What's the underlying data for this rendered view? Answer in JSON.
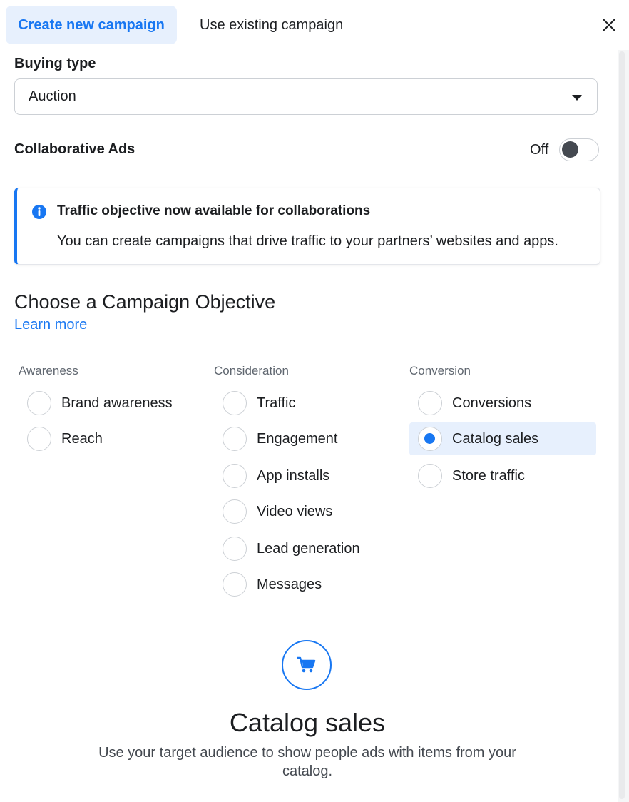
{
  "tabs": {
    "create": "Create new campaign",
    "existing": "Use existing campaign"
  },
  "icons": {
    "close": "close-icon",
    "info": "info-icon",
    "dropdown": "caret-down-icon",
    "cart": "shopping-cart-icon"
  },
  "buying_type": {
    "label": "Buying type",
    "value": "Auction"
  },
  "collaborative_ads": {
    "label": "Collaborative Ads",
    "state": "Off"
  },
  "banner": {
    "title": "Traffic objective now available for collaborations",
    "body": "You can create campaigns that drive traffic to your partners’ websites and apps."
  },
  "objective": {
    "heading": "Choose a Campaign Objective",
    "learn_more": "Learn more"
  },
  "columns": [
    {
      "title": "Awareness",
      "options": [
        "Brand awareness",
        "Reach"
      ]
    },
    {
      "title": "Consideration",
      "options": [
        "Traffic",
        "Engagement",
        "App installs",
        "Video views",
        "Lead generation",
        "Messages"
      ]
    },
    {
      "title": "Conversion",
      "options": [
        "Conversions",
        "Catalog sales",
        "Store traffic"
      ]
    }
  ],
  "selected_option": "Catalog sales",
  "detail": {
    "title": "Catalog sales",
    "description": "Use your target audience to show people ads with items from your catalog."
  },
  "colors": {
    "accent": "#1877f2",
    "accent_bg": "#e7f0fd",
    "text": "#1c1e21",
    "muted": "#606770"
  }
}
